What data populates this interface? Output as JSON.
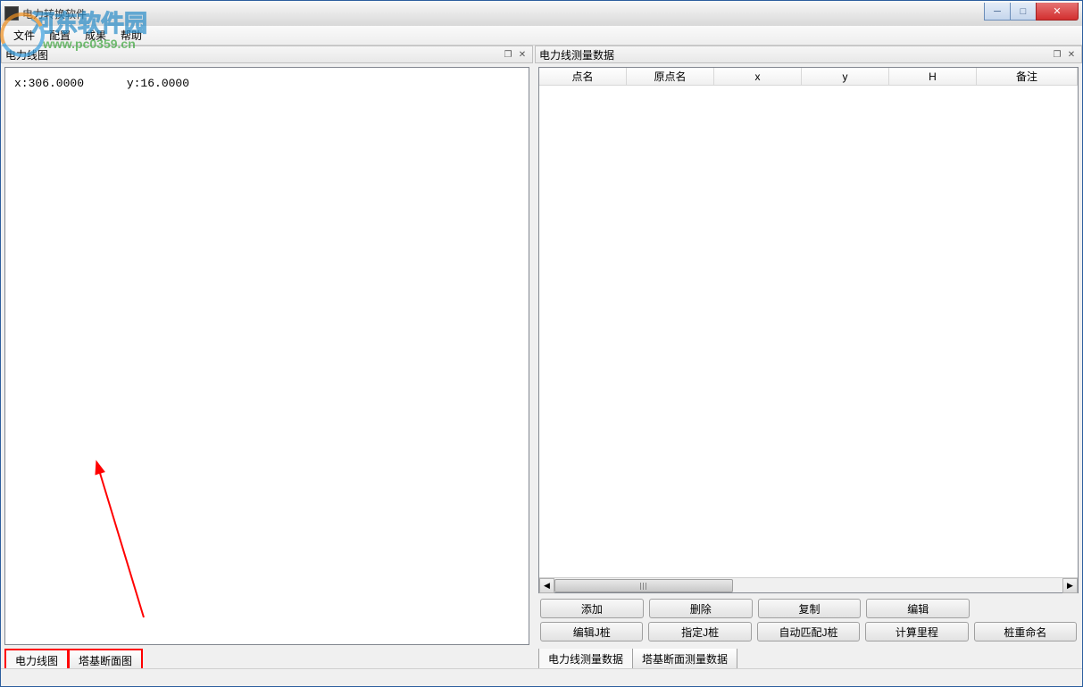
{
  "window": {
    "title": "电力转换软件"
  },
  "menubar": {
    "file": "文件",
    "config": "配置",
    "result": "成果",
    "help": "帮助"
  },
  "left_panel": {
    "title": "电力线图",
    "coords": {
      "x_label": "x:306.0000",
      "y_label": "y:16.0000"
    },
    "tabs": {
      "tab1": "电力线图",
      "tab2": "塔基断面图"
    }
  },
  "right_panel": {
    "title": "电力线测量数据",
    "columns": {
      "c1": "点名",
      "c2": "原点名",
      "c3": "x",
      "c4": "y",
      "c5": "H",
      "c6": "备注"
    },
    "buttons_row1": {
      "b1": "添加",
      "b2": "删除",
      "b3": "复制",
      "b4": "编辑"
    },
    "buttons_row2": {
      "b1": "编辑J桩",
      "b2": "指定J桩",
      "b3": "自动匹配J桩",
      "b4": "计算里程",
      "b5": "桩重命名"
    },
    "tabs": {
      "tab1": "电力线测量数据",
      "tab2": "塔基断面测量数据"
    }
  },
  "watermark": {
    "line1": "河东软件园",
    "line2": "www.pc0359.cn"
  }
}
